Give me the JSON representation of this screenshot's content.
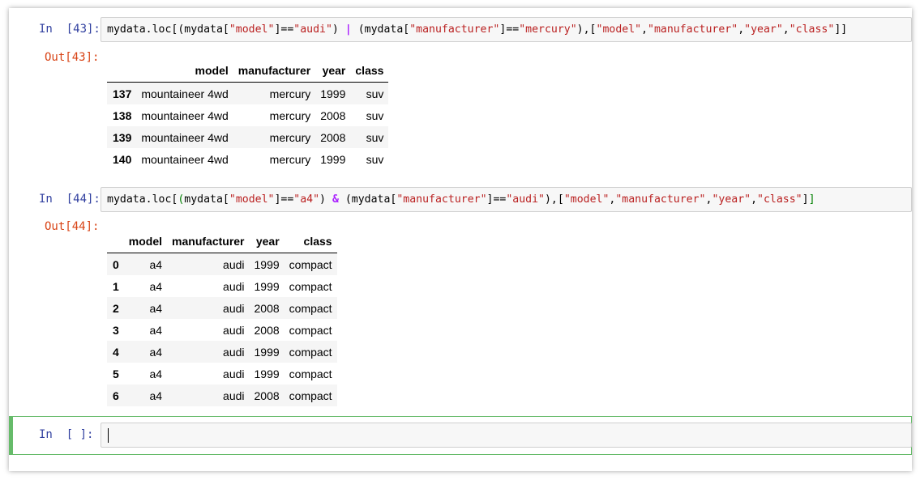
{
  "cells": [
    {
      "in_prompt": "In  [43]:",
      "out_prompt": "Out[43]:",
      "code_tokens": [
        {
          "t": "mydata.loc[(mydata[",
          "c": "plain"
        },
        {
          "t": "\"model\"",
          "c": "str"
        },
        {
          "t": "]==",
          "c": "plain"
        },
        {
          "t": "\"audi\"",
          "c": "str"
        },
        {
          "t": ") ",
          "c": "plain"
        },
        {
          "t": "|",
          "c": "op"
        },
        {
          "t": " (mydata[",
          "c": "plain"
        },
        {
          "t": "\"manufacturer\"",
          "c": "str"
        },
        {
          "t": "]==",
          "c": "plain"
        },
        {
          "t": "\"mercury\"",
          "c": "str"
        },
        {
          "t": "),[",
          "c": "plain"
        },
        {
          "t": "\"model\"",
          "c": "str"
        },
        {
          "t": ",",
          "c": "plain"
        },
        {
          "t": "\"manufacturer\"",
          "c": "str"
        },
        {
          "t": ",",
          "c": "plain"
        },
        {
          "t": "\"year\"",
          "c": "str"
        },
        {
          "t": ",",
          "c": "plain"
        },
        {
          "t": "\"class\"",
          "c": "str"
        },
        {
          "t": "]]",
          "c": "plain"
        }
      ],
      "table": {
        "columns": [
          "",
          "model",
          "manufacturer",
          "year",
          "class"
        ],
        "rows": [
          [
            "137",
            "mountaineer 4wd",
            "mercury",
            "1999",
            "suv"
          ],
          [
            "138",
            "mountaineer 4wd",
            "mercury",
            "2008",
            "suv"
          ],
          [
            "139",
            "mountaineer 4wd",
            "mercury",
            "2008",
            "suv"
          ],
          [
            "140",
            "mountaineer 4wd",
            "mercury",
            "1999",
            "suv"
          ]
        ]
      }
    },
    {
      "in_prompt": "In  [44]:",
      "out_prompt": "Out[44]:",
      "code_tokens": [
        {
          "t": "mydata.loc[",
          "c": "plain"
        },
        {
          "t": "(",
          "c": "green"
        },
        {
          "t": "mydata[",
          "c": "plain"
        },
        {
          "t": "\"model\"",
          "c": "str"
        },
        {
          "t": "]==",
          "c": "plain"
        },
        {
          "t": "\"a4\"",
          "c": "str"
        },
        {
          "t": ") ",
          "c": "plain"
        },
        {
          "t": "&",
          "c": "op"
        },
        {
          "t": " (mydata[",
          "c": "plain"
        },
        {
          "t": "\"manufacturer\"",
          "c": "str"
        },
        {
          "t": "]==",
          "c": "plain"
        },
        {
          "t": "\"audi\"",
          "c": "str"
        },
        {
          "t": "),[",
          "c": "plain"
        },
        {
          "t": "\"model\"",
          "c": "str"
        },
        {
          "t": ",",
          "c": "plain"
        },
        {
          "t": "\"manufacturer\"",
          "c": "str"
        },
        {
          "t": ",",
          "c": "plain"
        },
        {
          "t": "\"year\"",
          "c": "str"
        },
        {
          "t": ",",
          "c": "plain"
        },
        {
          "t": "\"class\"",
          "c": "str"
        },
        {
          "t": "]",
          "c": "plain"
        },
        {
          "t": "]",
          "c": "green"
        }
      ],
      "table": {
        "columns": [
          "",
          "model",
          "manufacturer",
          "year",
          "class"
        ],
        "rows": [
          [
            "0",
            "a4",
            "audi",
            "1999",
            "compact"
          ],
          [
            "1",
            "a4",
            "audi",
            "1999",
            "compact"
          ],
          [
            "2",
            "a4",
            "audi",
            "2008",
            "compact"
          ],
          [
            "3",
            "a4",
            "audi",
            "2008",
            "compact"
          ],
          [
            "4",
            "a4",
            "audi",
            "1999",
            "compact"
          ],
          [
            "5",
            "a4",
            "audi",
            "1999",
            "compact"
          ],
          [
            "6",
            "a4",
            "audi",
            "2008",
            "compact"
          ]
        ]
      }
    }
  ],
  "empty_cell": {
    "in_prompt": "In  [ ]:",
    "value": ""
  },
  "colors": {
    "in_prompt": "#303f9f",
    "out_prompt": "#d84315",
    "string": "#ba2121",
    "operator": "#aa22ff",
    "selected_border": "#66bb6a"
  }
}
